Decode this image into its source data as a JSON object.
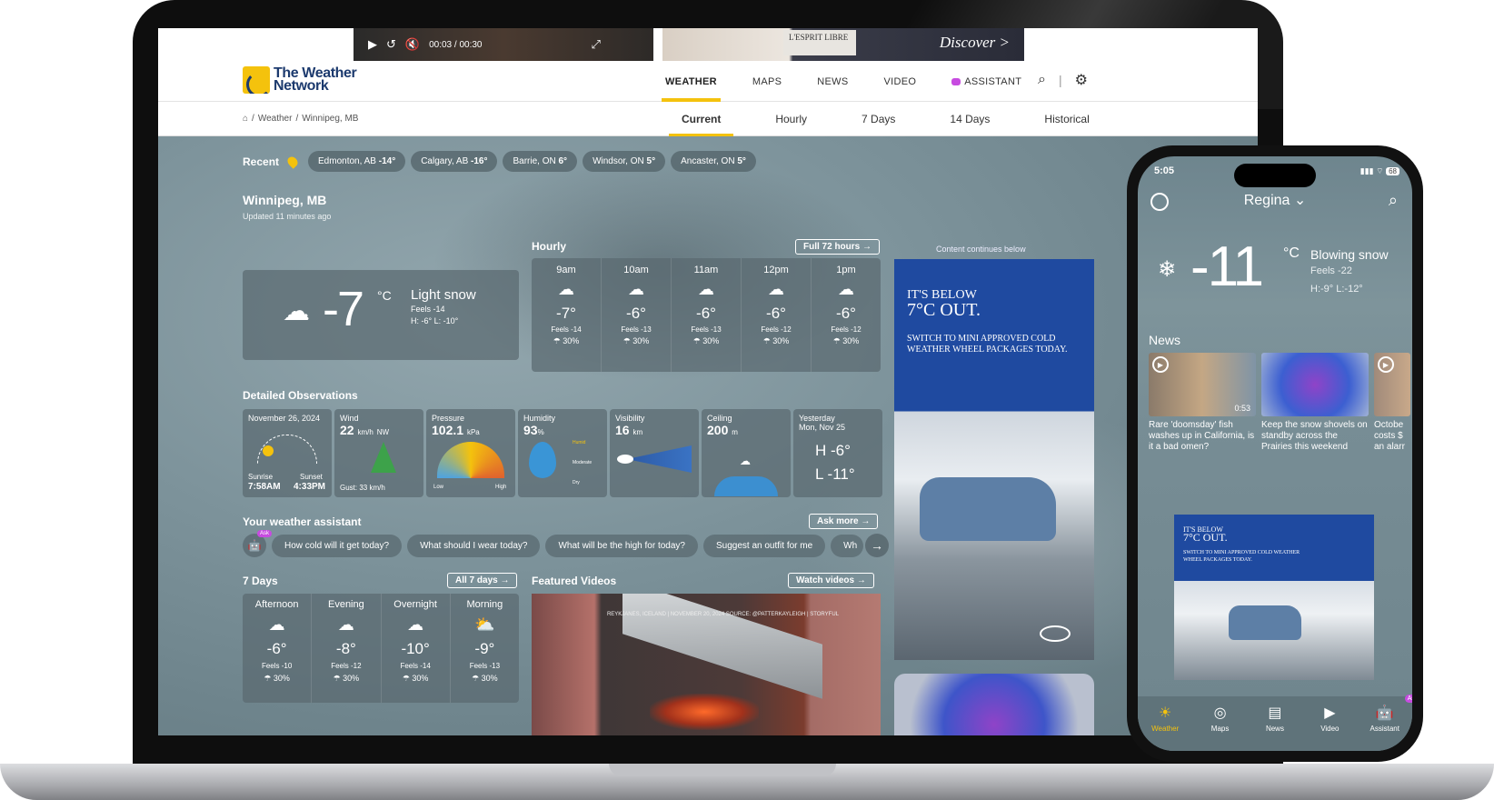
{
  "ad_top": {
    "video_time": "00:03 / 00:30",
    "esprit": "L'ESPRIT LIBRE",
    "discover": "Discover >"
  },
  "logo": {
    "line1": "The Weather",
    "line2": "Network"
  },
  "nav": [
    {
      "label": "WEATHER"
    },
    {
      "label": "MAPS"
    },
    {
      "label": "NEWS"
    },
    {
      "label": "VIDEO"
    },
    {
      "label": "ASSISTANT"
    }
  ],
  "breadcrumb": {
    "weather": "Weather",
    "city": "Winnipeg, MB"
  },
  "tabs": [
    "Current",
    "Hourly",
    "7 Days",
    "14 Days",
    "Historical"
  ],
  "recent": {
    "label": "Recent",
    "chips": [
      {
        "city": "Edmonton, AB",
        "temp": "-14°"
      },
      {
        "city": "Calgary, AB",
        "temp": "-16°"
      },
      {
        "city": "Barrie, ON",
        "temp": "6°"
      },
      {
        "city": "Windsor, ON",
        "temp": "5°"
      },
      {
        "city": "Ancaster, ON",
        "temp": "5°"
      }
    ]
  },
  "location": {
    "city": "Winnipeg, MB",
    "updated": "Updated 11 minutes ago"
  },
  "current": {
    "temp": "-7",
    "unit": "°C",
    "condition": "Light snow",
    "feels": "Feels -14",
    "hl": "H: -6°   L: -10°"
  },
  "hourly": {
    "title": "Hourly",
    "button": "Full 72 hours →",
    "items": [
      {
        "time": "9am",
        "temp": "-7°",
        "feels": "Feels -14",
        "pop": "30%"
      },
      {
        "time": "10am",
        "temp": "-6°",
        "feels": "Feels -13",
        "pop": "30%"
      },
      {
        "time": "11am",
        "temp": "-6°",
        "feels": "Feels -13",
        "pop": "30%"
      },
      {
        "time": "12pm",
        "temp": "-6°",
        "feels": "Feels -12",
        "pop": "30%"
      },
      {
        "time": "1pm",
        "temp": "-6°",
        "feels": "Feels -12",
        "pop": "30%"
      }
    ]
  },
  "ad_side": {
    "label": "Content continues below",
    "h1": "IT'S BELOW",
    "h2": "7°C OUT.",
    "sub": "SWITCH TO MINI APPROVED COLD WEATHER WHEEL PACKAGES TODAY."
  },
  "observations": {
    "title": "Detailed Observations",
    "date": "November 26, 2024",
    "sunrise_label": "Sunrise",
    "sunrise": "7:58AM",
    "sunset_label": "Sunset",
    "sunset": "4:33PM",
    "wind_label": "Wind",
    "wind": "22",
    "wind_unit": "km/h",
    "wind_dir": "NW",
    "gust": "Gust: 33 km/h",
    "pressure_label": "Pressure",
    "pressure": "102.1",
    "pressure_unit": "kPa",
    "pressure_low": "Low",
    "pressure_high": "High",
    "humidity_label": "Humidity",
    "humidity": "93",
    "humidity_unit": "%",
    "humid": "Humid",
    "moderate": "Moderate",
    "dry": "Dry",
    "visibility_label": "Visibility",
    "visibility": "16",
    "visibility_unit": "km",
    "ceiling_label": "Ceiling",
    "ceiling": "200",
    "ceiling_unit": "m",
    "yesterday_label": "Yesterday",
    "yesterday_date": "Mon, Nov 25",
    "y_high": "H  -6°",
    "y_low": "L  -11°"
  },
  "assistant": {
    "title": "Your weather assistant",
    "button": "Ask more →",
    "ask": "Ask",
    "questions": [
      "How cold will it get today?",
      "What should I wear today?",
      "What will be the high for today?",
      "Suggest an outfit for me",
      "Wh"
    ]
  },
  "days7": {
    "title": "7 Days",
    "button": "All 7 days →",
    "items": [
      {
        "label": "Afternoon",
        "temp": "-6°",
        "feels": "Feels -10",
        "pop": "30%"
      },
      {
        "label": "Evening",
        "temp": "-8°",
        "feels": "Feels -12",
        "pop": "30%"
      },
      {
        "label": "Overnight",
        "temp": "-10°",
        "feels": "Feels -14",
        "pop": "30%"
      },
      {
        "label": "Morning",
        "temp": "-9°",
        "feels": "Feels -13",
        "pop": "30%"
      }
    ]
  },
  "videos": {
    "title": "Featured Videos",
    "button": "Watch videos →",
    "caption": "REYKJANES, ICELAND | NOVEMBER 20, 2024 SOURCE: @PATTERKAYLEIGH | STORYFUL"
  },
  "phone": {
    "time": "5:05",
    "battery": "68",
    "city": "Regina ⌄",
    "temp": "-11",
    "unit": "°C",
    "condition": "Blowing snow",
    "feels": "Feels -22",
    "hl": "H:-9°  L:-12°",
    "news_title": "News",
    "news": [
      {
        "caption": "Rare 'doomsday' fish washes up in California, is it a bad omen?",
        "duration": "0:53"
      },
      {
        "caption": "Keep the snow shovels on standby across the Prairies this weekend",
        "duration": ""
      },
      {
        "caption": "Octobe costs $ an alarr",
        "duration": ""
      }
    ],
    "ad_h1": "IT'S BELOW",
    "ad_h2": "7°C OUT.",
    "ad_sub": "SWITCH TO MINI APPROVED COLD WEATHER WHEEL PACKAGES TODAY.",
    "tabs": [
      "Weather",
      "Maps",
      "News",
      "Video",
      "Assistant"
    ],
    "ask": "Ask"
  }
}
